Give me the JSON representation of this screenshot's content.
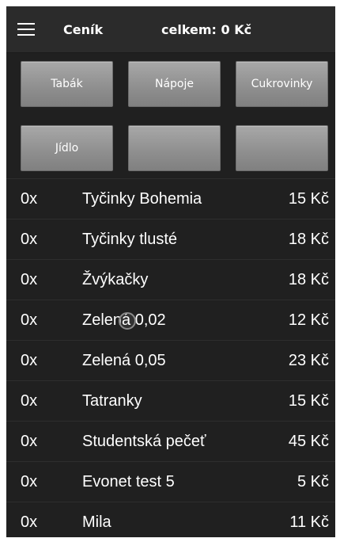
{
  "header": {
    "title": "Ceník",
    "total_label": "celkem:",
    "total_value": "0 Kč"
  },
  "categories": [
    "Tabák",
    "Nápoje",
    "Cukrovinky",
    "Jídlo",
    "",
    ""
  ],
  "products": [
    {
      "qty": "0x",
      "name": "Tyčinky Bohemia",
      "price": "15 Kč"
    },
    {
      "qty": "0x",
      "name": "Tyčinky tlusté",
      "price": "18 Kč"
    },
    {
      "qty": "0x",
      "name": "Žvýkačky",
      "price": "18 Kč"
    },
    {
      "qty": "0x",
      "name": "Zelená 0,02",
      "price": "12 Kč"
    },
    {
      "qty": "0x",
      "name": "Zelená 0,05",
      "price": "23 Kč"
    },
    {
      "qty": "0x",
      "name": "Tatranky",
      "price": "15 Kč"
    },
    {
      "qty": "0x",
      "name": "Studentská pečeť",
      "price": "45 Kč"
    },
    {
      "qty": "0x",
      "name": "Evonet test 5",
      "price": "5 Kč"
    },
    {
      "qty": "0x",
      "name": "Mila",
      "price": "11 Kč"
    }
  ]
}
